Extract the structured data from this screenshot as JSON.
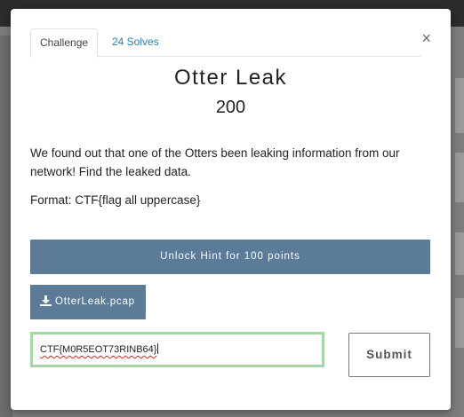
{
  "modal": {
    "close_symbol": "×",
    "tabs": [
      {
        "label": "Challenge",
        "active": true
      },
      {
        "label": "24 Solves",
        "active": false
      }
    ],
    "challenge": {
      "name": "Otter Leak",
      "points": "200",
      "description": "We found out that one of the Otters been leaking information from our network! Find the leaked data.",
      "format": "Format: CTF{flag all uppercase}"
    },
    "hint_button": "Unlock Hint for 100 points",
    "file_button": {
      "label": "OtterLeak.pcap",
      "icon": "download-icon"
    },
    "flag_input": {
      "value": "CTF{M0R5EOT73RINB64}"
    },
    "submit_button": "Submit"
  },
  "colors": {
    "button_bg": "#5b7b99",
    "tab_link": "#2a7fb0",
    "input_focus_border": "#a5d6a7",
    "overlay": "#7d7d7d",
    "topbar": "#2b2b2b"
  }
}
